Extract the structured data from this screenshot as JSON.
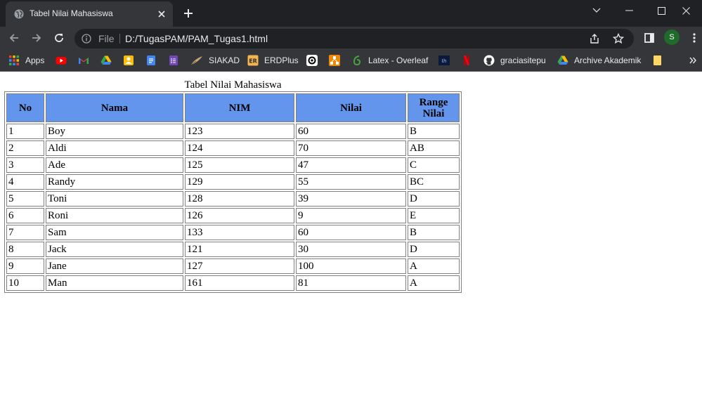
{
  "browser": {
    "tab_title": "Tabel Nilai Mahasiswa",
    "omnibox_scheme": "File",
    "url": "D:/TugasPAM/PAM_Tugas1.html",
    "profile_initial": "S"
  },
  "bookmarks": [
    {
      "label": "Apps",
      "icon": "apps-grid-icon"
    },
    {
      "label": "",
      "icon": "youtube-icon"
    },
    {
      "label": "",
      "icon": "gmail-icon"
    },
    {
      "label": "",
      "icon": "google-drive-icon"
    },
    {
      "label": "",
      "icon": "google-photos-icon"
    },
    {
      "label": "",
      "icon": "google-docs-icon"
    },
    {
      "label": "",
      "icon": "google-forms-icon"
    },
    {
      "label": "SIAKAD",
      "icon": "quill-icon"
    },
    {
      "label": "ERDPlus",
      "icon": "erdplus-icon"
    },
    {
      "label": "",
      "icon": "openai-icon"
    },
    {
      "label": "",
      "icon": "diagram-icon"
    },
    {
      "label": "Latex - Overleaf",
      "icon": "overleaf-icon"
    },
    {
      "label": "",
      "icon": "dh-icon"
    },
    {
      "label": "",
      "icon": "netflix-icon"
    },
    {
      "label": "graciasitepu",
      "icon": "github-icon"
    },
    {
      "label": "Archive Akademik",
      "icon": "google-drive-icon"
    },
    {
      "label": "",
      "icon": "folder-icon"
    }
  ],
  "table": {
    "caption": "Tabel Nilai Mahasiswa",
    "headers": [
      "No",
      "Nama",
      "NIM",
      "Nilai",
      "Range Nilai"
    ],
    "rows": [
      [
        "1",
        "Boy",
        "123",
        "60",
        "B"
      ],
      [
        "2",
        "Aldi",
        "124",
        "70",
        "AB"
      ],
      [
        "3",
        "Ade",
        "125",
        "47",
        "C"
      ],
      [
        "4",
        "Randy",
        "129",
        "55",
        "BC"
      ],
      [
        "5",
        "Toni",
        "128",
        "39",
        "D"
      ],
      [
        "6",
        "Roni",
        "126",
        "9",
        "E"
      ],
      [
        "7",
        "Sam",
        "133",
        "60",
        "B"
      ],
      [
        "8",
        "Jack",
        "121",
        "30",
        "D"
      ],
      [
        "9",
        "Jane",
        "127",
        "100",
        "A"
      ],
      [
        "10",
        "Man",
        "161",
        "81",
        "A"
      ]
    ]
  },
  "colors": {
    "header_background": "#6495ed",
    "chrome_dark": "#202124",
    "chrome_toolbar": "#35363a"
  }
}
